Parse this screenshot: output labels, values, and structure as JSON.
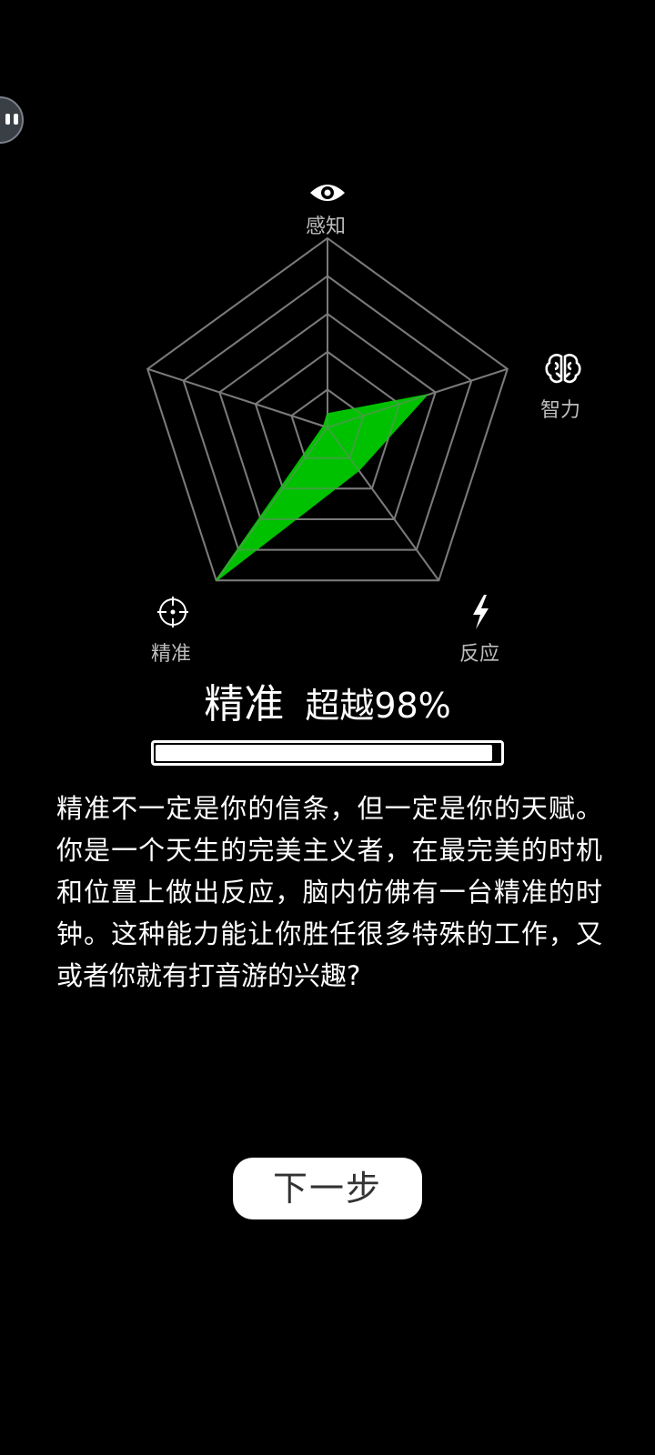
{
  "radar": {
    "axes": [
      {
        "label": "感知",
        "icon": "eye-icon",
        "value": 0.07
      },
      {
        "label": "智力",
        "icon": "brain-icon",
        "value": 0.55
      },
      {
        "label": "反应",
        "icon": "lightning-icon",
        "value": 0.28
      },
      {
        "label": "精准",
        "icon": "crosshair-icon",
        "value": 1.0
      },
      {
        "label": "",
        "icon": "",
        "value": 0.0
      }
    ],
    "fill_color": "#00cc00",
    "grid_color": "#7a7a7a",
    "levels": 5
  },
  "result": {
    "trait": "精准",
    "surpass": "超越98%",
    "progress": 0.98
  },
  "description": "精准不一定是你的信条，但一定是你的天赋。你是一个天生的完美主义者，在最完美的时机和位置上做出反应，脑内仿佛有一台精准的时钟。这种能力能让你胜任很多特殊的工作，又或者你就有打音游的兴趣?",
  "next_button": {
    "label": "下一步"
  }
}
